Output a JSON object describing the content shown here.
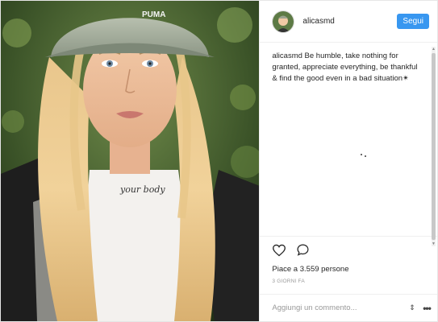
{
  "post": {
    "username": "alicasmd",
    "follow_label": "Segui",
    "caption_user": "alicasmd",
    "caption_text": "Be humble, take nothing for granted, appreciate everything, be thankful & find the good even in a bad situation✴",
    "likes_text": "Piace a 3.559 persone",
    "timestamp": "3 GIORNI FA",
    "comment_placeholder": "Aggiungi un commento...",
    "shirt_text": "your body",
    "cap_brand": "PUMA"
  },
  "icons": {
    "like": "heart-outline-icon",
    "comment": "speech-bubble-icon",
    "spin": "up-down-arrows-icon",
    "more": "ellipsis-icon"
  },
  "colors": {
    "accent": "#3897f0",
    "text": "#262626",
    "muted": "#999999",
    "border": "#efefef"
  }
}
